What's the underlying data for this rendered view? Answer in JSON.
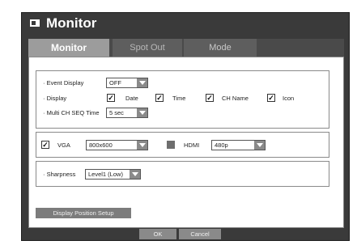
{
  "window": {
    "title": "Monitor",
    "title_icon": "monitor-icon"
  },
  "tabs": [
    {
      "label": "Monitor",
      "active": true
    },
    {
      "label": "Spot Out",
      "active": false
    },
    {
      "label": "Mode",
      "active": false
    }
  ],
  "settings": {
    "event_display": {
      "label": "· Event Display",
      "value": "OFF"
    },
    "display": {
      "label": "· Display",
      "options": [
        {
          "label": "Date",
          "checked": true
        },
        {
          "label": "Time",
          "checked": true
        },
        {
          "label": "CH Name",
          "checked": true
        },
        {
          "label": "Icon",
          "checked": true
        }
      ]
    },
    "multi_ch_seq_time": {
      "label": "· Multi CH SEQ Time",
      "value": "5 sec"
    }
  },
  "outputs": {
    "vga": {
      "label": "VGA",
      "checked": true,
      "resolution": "800x600"
    },
    "hdmi": {
      "label": "HDMI",
      "checked": false,
      "resolution": "480p"
    }
  },
  "sharpness": {
    "label": "· Sharpness",
    "value": "Level1 (Low)"
  },
  "buttons": {
    "display_position_setup": "Display Position Setup",
    "ok": "OK",
    "cancel": "Cancel"
  },
  "colors": {
    "frame": "#3a3a3a",
    "active_tab": "#9c9c9c",
    "button": "#7c7c7c"
  }
}
